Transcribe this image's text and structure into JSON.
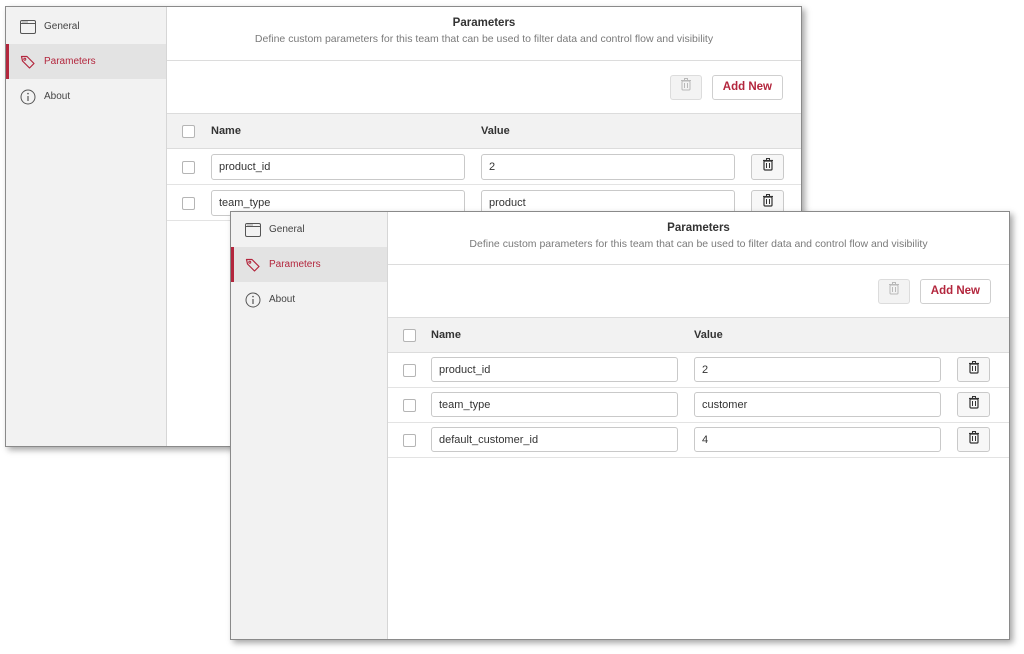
{
  "windows": [
    {
      "sidebar": {
        "items": [
          {
            "label": "General",
            "icon": "window-icon"
          },
          {
            "label": "Parameters",
            "icon": "tag-icon"
          },
          {
            "label": "About",
            "icon": "info-icon"
          }
        ]
      },
      "header": {
        "title": "Parameters",
        "subtitle": "Define custom parameters for this team that can be used to filter data and control flow and visibility"
      },
      "toolbar": {
        "add_label": "Add New"
      },
      "grid": {
        "columns": {
          "name": "Name",
          "value": "Value"
        },
        "rows": [
          {
            "name": "product_id",
            "value": "2"
          },
          {
            "name": "team_type",
            "value": "product"
          }
        ]
      }
    },
    {
      "sidebar": {
        "items": [
          {
            "label": "General",
            "icon": "window-icon"
          },
          {
            "label": "Parameters",
            "icon": "tag-icon"
          },
          {
            "label": "About",
            "icon": "info-icon"
          }
        ]
      },
      "header": {
        "title": "Parameters",
        "subtitle": "Define custom parameters for this team that can be used to filter data and control flow and visibility"
      },
      "toolbar": {
        "add_label": "Add New"
      },
      "grid": {
        "columns": {
          "name": "Name",
          "value": "Value"
        },
        "rows": [
          {
            "name": "product_id",
            "value": "2"
          },
          {
            "name": "team_type",
            "value": "customer"
          },
          {
            "name": "default_customer_id",
            "value": "4"
          }
        ]
      }
    }
  ],
  "colors": {
    "accent": "#b3263d",
    "sidebar_bg": "#f2f2f2",
    "active_bg": "#e3e3e3"
  }
}
